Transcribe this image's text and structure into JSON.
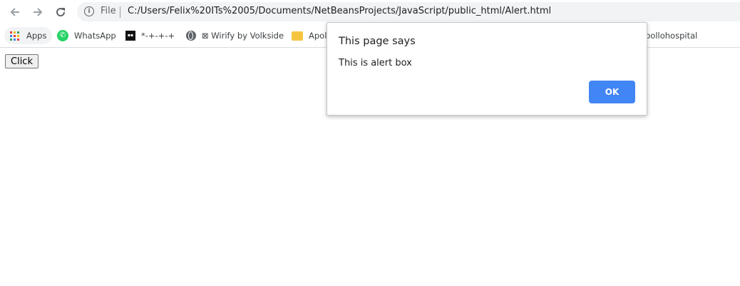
{
  "browser": {
    "nav": {
      "back_icon": "arrow-left-icon",
      "forward_icon": "arrow-right-icon",
      "reload_icon": "reload-icon"
    },
    "omnibox": {
      "info_icon": "info-icon",
      "scheme_label": "File",
      "url": "C:/Users/Felix%20ITs%2005/Documents/NetBeansProjects/JavaScript/public_html/Alert.html"
    }
  },
  "bookmarks": [
    {
      "label": "Apps",
      "icon": "apps-grid-icon"
    },
    {
      "label": "WhatsApp",
      "icon": "whatsapp-icon"
    },
    {
      "label": "*-+-+-+",
      "icon": "dark-square-icon"
    },
    {
      "label": "⊠ Wirify by Volkside",
      "icon": "globe-icon"
    },
    {
      "label": "Apol",
      "icon": "folder-icon"
    },
    {
      "label": "pollohospital",
      "icon": ""
    }
  ],
  "page": {
    "button_label": "Click"
  },
  "alert": {
    "title": "This page says",
    "message": "This is alert box",
    "ok_label": "OK",
    "accent_color": "#4285f4"
  }
}
